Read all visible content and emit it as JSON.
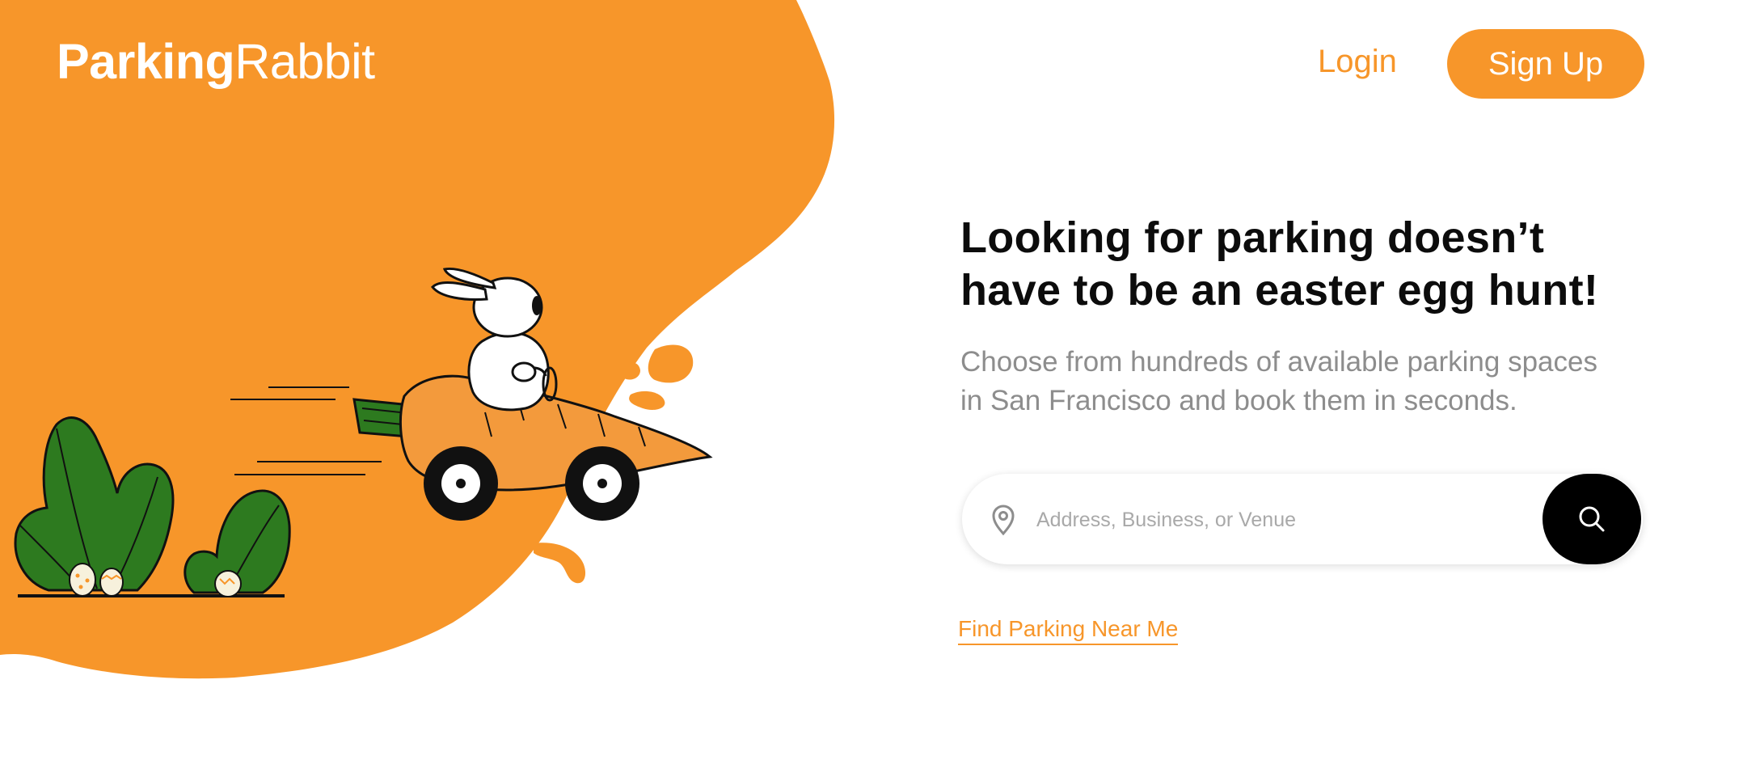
{
  "brand": {
    "name_bold": "Parking",
    "name_light": "Rabbit"
  },
  "nav": {
    "login_label": "Login",
    "signup_label": "Sign Up"
  },
  "hero": {
    "headline_line1": "Looking for parking doesn’t",
    "headline_line2": "have to be an easter egg hunt!",
    "subtext_line1": "Choose from hundreds of available parking spaces",
    "subtext_line2": "in San Francisco and book them in seconds."
  },
  "search": {
    "placeholder": "Address, Business, or Venue",
    "value": ""
  },
  "find_near_me_label": "Find Parking Near Me",
  "icons": {
    "location": "location-pin-icon",
    "search": "search-icon"
  },
  "colors": {
    "accent": "#f7962a",
    "carrot": "#f39a3c",
    "leaf": "#2f7a20",
    "text_dark": "#0c0c0c",
    "text_muted": "#8d8d8d",
    "search_button": "#000000"
  }
}
